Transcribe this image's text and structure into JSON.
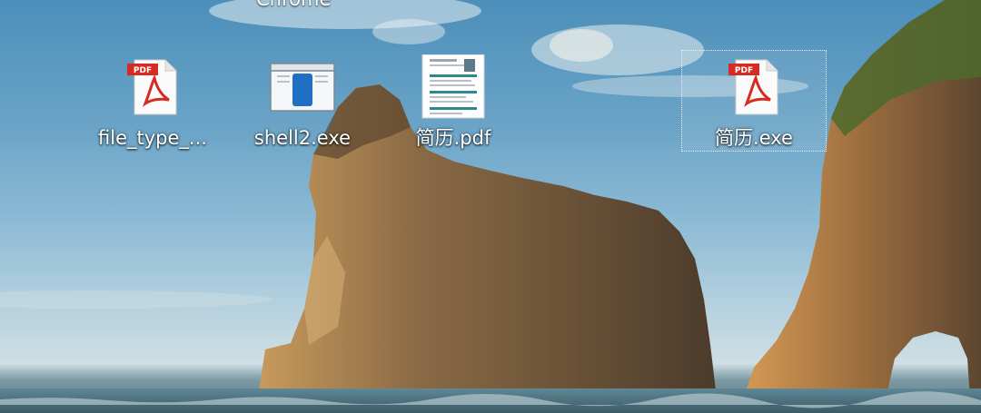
{
  "desktop": {
    "top_partial_label": "Chrome",
    "icons": [
      {
        "label": "file_type_...",
        "icon": "pdf-file-icon",
        "selected": false
      },
      {
        "label": "shell2.exe",
        "icon": "application-window-icon",
        "selected": false
      },
      {
        "label": "简历.pdf",
        "icon": "document-thumbnail-icon",
        "selected": false
      },
      {
        "label": "简历.exe",
        "icon": "pdf-file-icon",
        "selected": true
      }
    ]
  },
  "icon_badge_text": "PDF",
  "colors": {
    "pdf_red": "#d62b22",
    "app_blue": "#1f6fc4",
    "sky": "#6aa3c6",
    "rock": "#6b5235",
    "label_text": "#ffffff"
  }
}
